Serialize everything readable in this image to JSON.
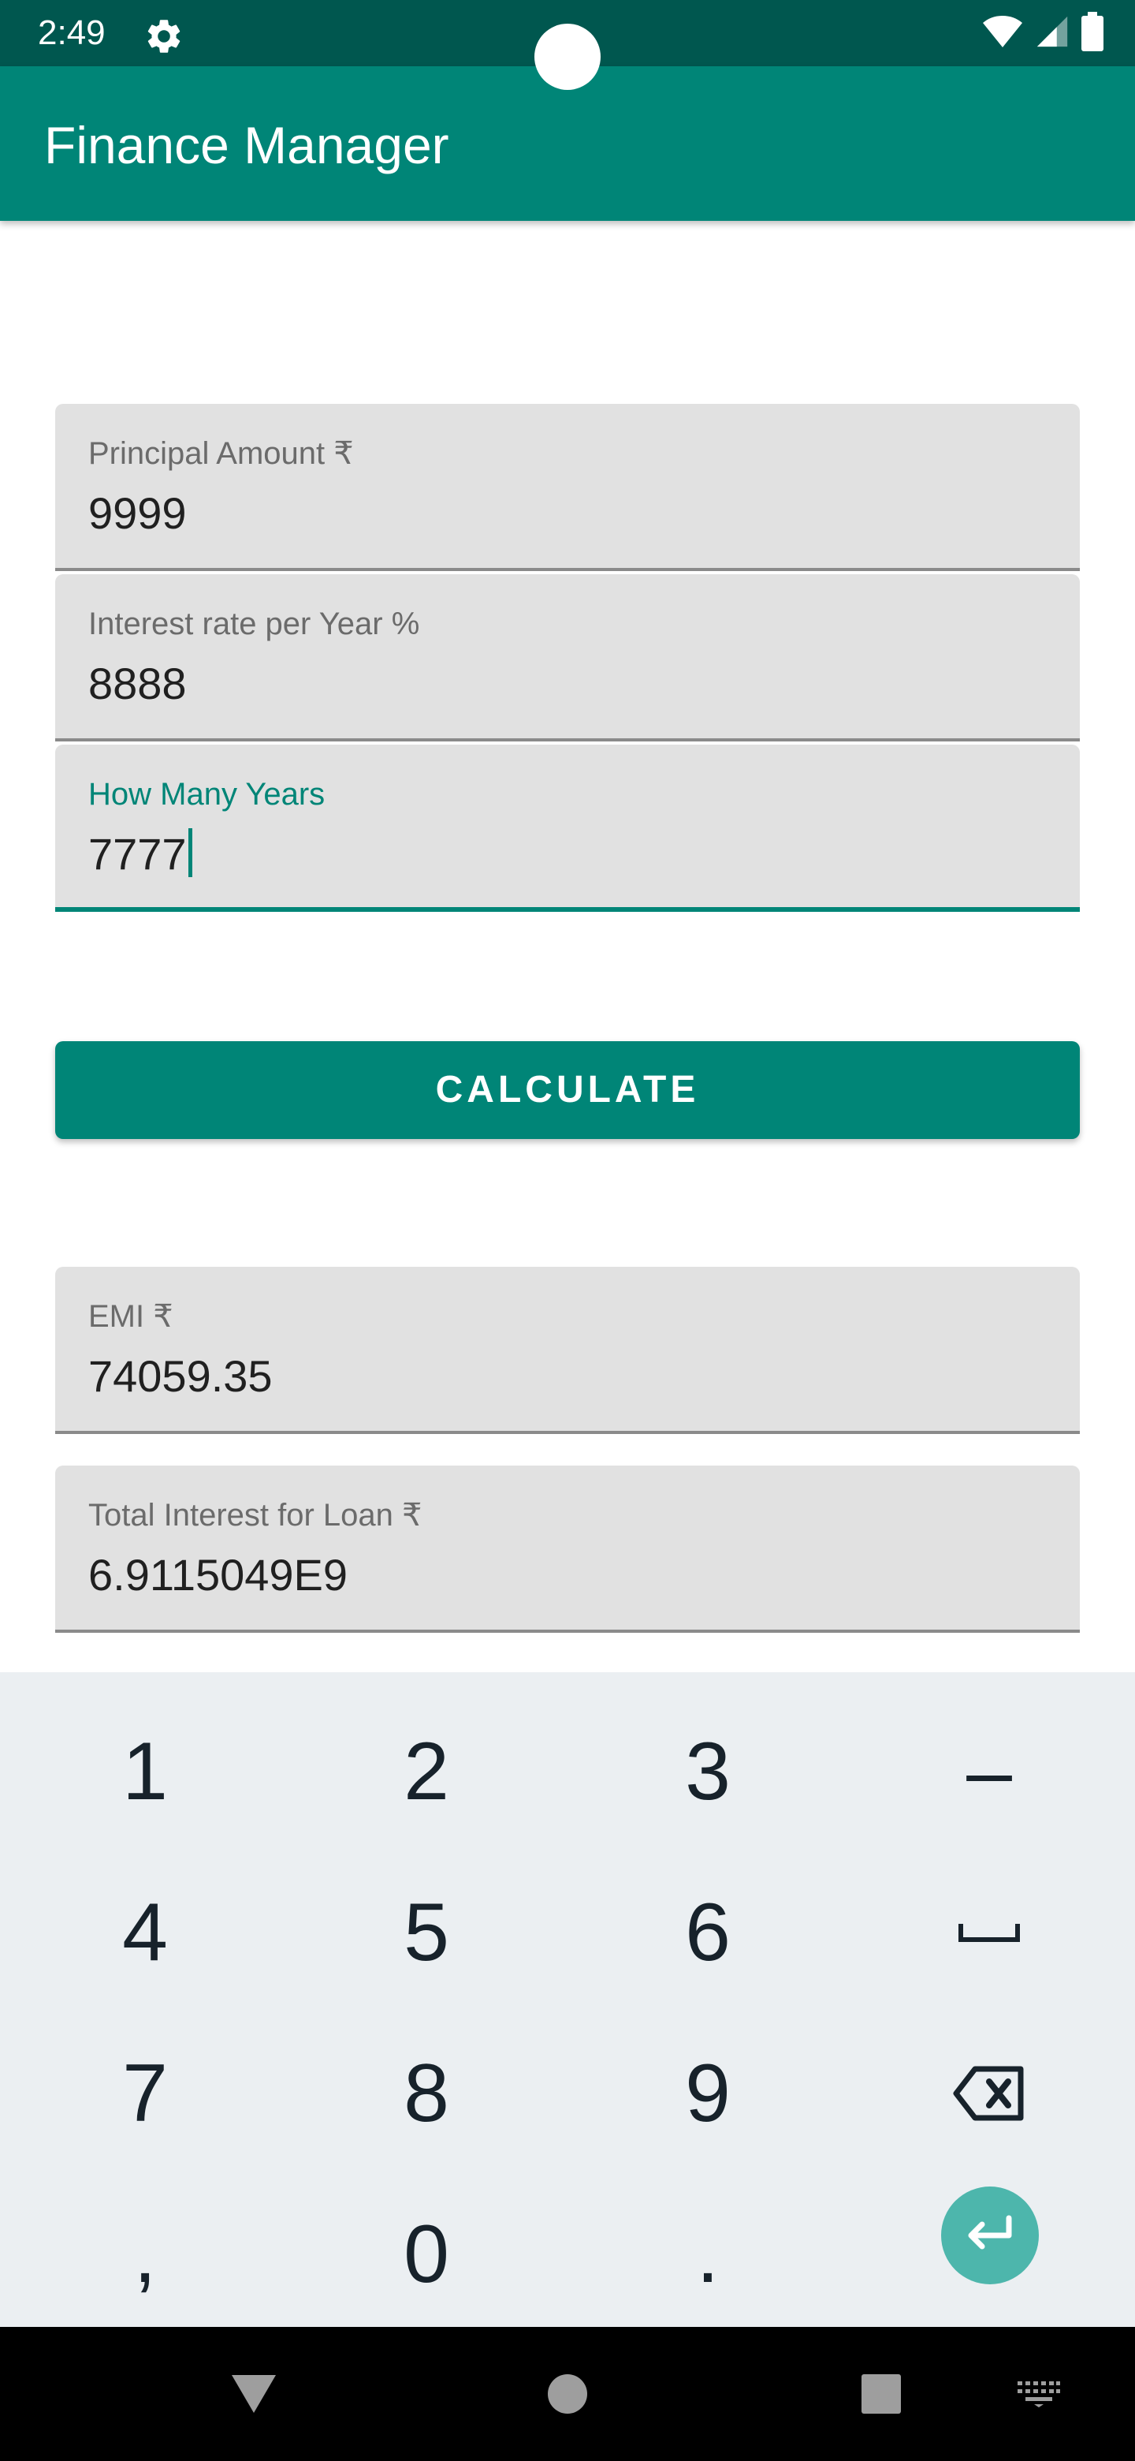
{
  "status_bar": {
    "time": "2:49",
    "icons": [
      "settings-gear-icon",
      "wifi-icon",
      "cell-signal-icon",
      "battery-icon"
    ]
  },
  "app_bar": {
    "title": "Finance Manager"
  },
  "form": {
    "principal": {
      "label": "Principal Amount ₹",
      "value": "9999"
    },
    "interest": {
      "label": "Interest rate per Year %",
      "value": "8888"
    },
    "years": {
      "label": "How Many Years",
      "value": "7777"
    }
  },
  "calculate_button": {
    "label": "CALCULATE"
  },
  "results": {
    "emi": {
      "label": "EMI ₹",
      "value": "74059.35"
    },
    "total_interest": {
      "label": "Total Interest for Loan ₹",
      "value": "6.9115049E9"
    }
  },
  "keyboard": {
    "keys": [
      "1",
      "2",
      "3",
      "–",
      "4",
      "5",
      "6",
      "7",
      "8",
      "9",
      ",",
      "0",
      "."
    ],
    "icons": [
      "space-icon",
      "backspace-icon",
      "enter-icon"
    ]
  },
  "nav_bar": {
    "icons": [
      "back-icon",
      "home-icon",
      "recents-icon",
      "keyboard-switch-icon"
    ]
  },
  "colors": {
    "primary": "#008577",
    "primary_dark": "#00574f",
    "accent": "#4db6ac",
    "field_background": "#e1e1e1",
    "keyboard_background": "#ebeff2"
  }
}
